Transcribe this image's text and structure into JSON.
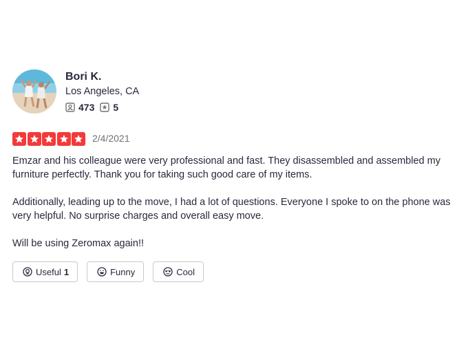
{
  "reviewer": {
    "name": "Bori K.",
    "location": "Los Angeles, CA",
    "friends_count": "473",
    "reviews_count": "5"
  },
  "review": {
    "rating": 5,
    "rating_max": 5,
    "star_color": "#f43939",
    "date": "2/4/2021",
    "paragraphs": [
      "Emzar and his colleague were very professional and fast. They disassembled and assembled my furniture perfectly. Thank you for taking such good care of my items.",
      "Additionally, leading up to the move, I had a lot of questions. Everyone I spoke to on the phone was very helpful. No surprise charges and overall easy move.",
      "Will be using Zeromax again!!"
    ]
  },
  "reactions": {
    "useful_label": "Useful",
    "useful_count": "1",
    "funny_label": "Funny",
    "cool_label": "Cool"
  }
}
